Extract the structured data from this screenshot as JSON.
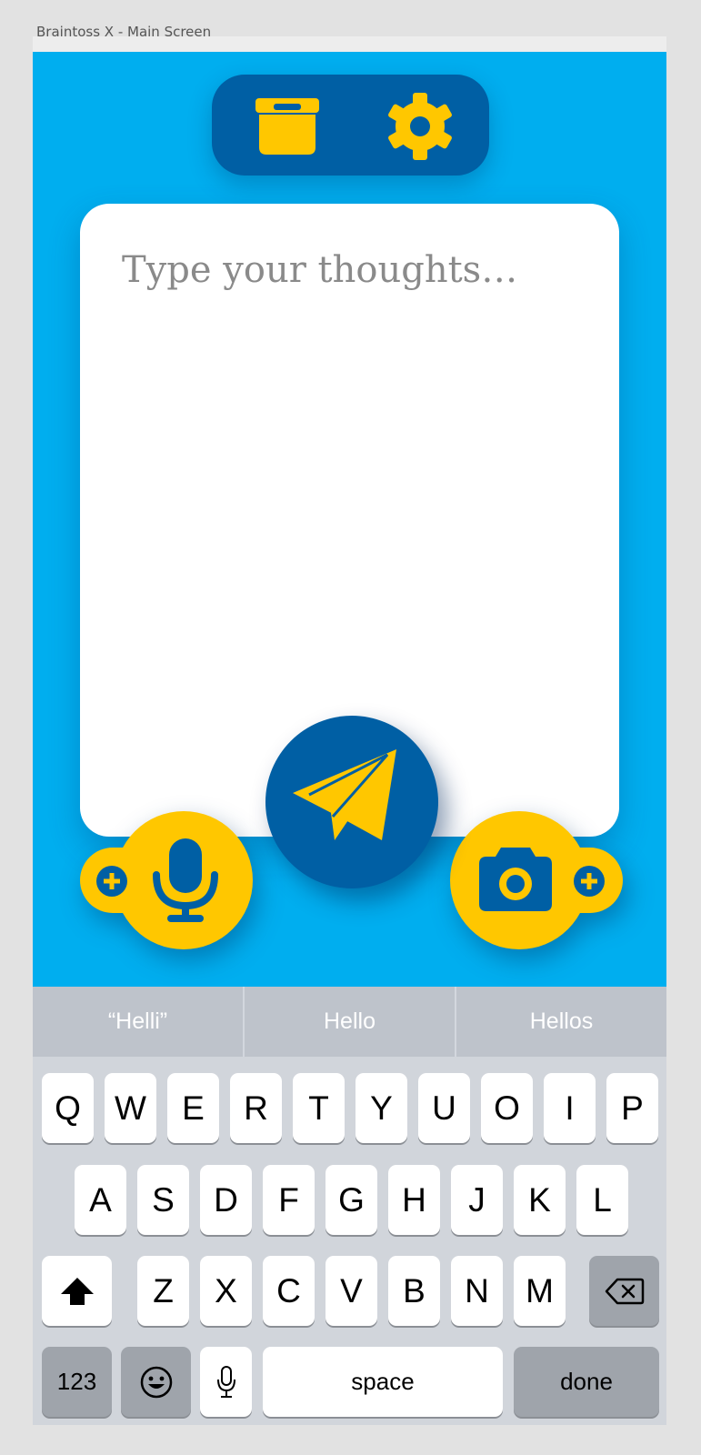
{
  "window": {
    "title": "Braintoss X - Main Screen"
  },
  "composer": {
    "placeholder": "Type your thoughts…"
  },
  "toolbar": {
    "archive_icon": "archive-box-icon",
    "settings_icon": "gear-icon"
  },
  "actions": {
    "send_icon": "paper-plane-icon",
    "voice_icon": "microphone-icon",
    "camera_icon": "camera-icon",
    "add_icon": "plus-circle-icon"
  },
  "colors": {
    "background": "#00aeef",
    "primary_dark": "#005fa4",
    "accent": "#ffc700",
    "card": "#ffffff"
  },
  "keyboard": {
    "suggestions": [
      "“Helli”",
      "Hello",
      "Hellos"
    ],
    "row1": [
      "Q",
      "W",
      "E",
      "R",
      "T",
      "Y",
      "U",
      "O",
      "I",
      "P"
    ],
    "row2": [
      "A",
      "S",
      "D",
      "F",
      "G",
      "H",
      "J",
      "K",
      "L"
    ],
    "row3": [
      "Z",
      "X",
      "C",
      "V",
      "B",
      "N",
      "M"
    ],
    "numbers_label": "123",
    "space_label": "space",
    "done_label": "done",
    "shift_icon": "shift-arrow-icon",
    "backspace_icon": "backspace-icon",
    "emoji_icon": "emoji-face-icon",
    "dictation_icon": "microphone-icon"
  }
}
